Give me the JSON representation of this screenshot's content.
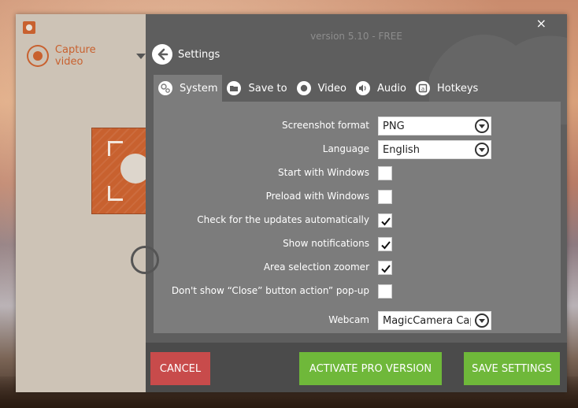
{
  "app": {
    "version": "version 5.10 - FREE",
    "close_symbol": "×"
  },
  "left": {
    "capture_label": "Capture video"
  },
  "header": {
    "back_label": "Settings"
  },
  "tabs": [
    {
      "label": "System",
      "icon": "gears-icon",
      "active": true
    },
    {
      "label": "Save to",
      "icon": "folder-icon",
      "active": false
    },
    {
      "label": "Video",
      "icon": "record-icon",
      "active": false
    },
    {
      "label": "Audio",
      "icon": "speaker-icon",
      "active": false
    },
    {
      "label": "Hotkeys",
      "icon": "keyboard-key-icon",
      "active": false
    }
  ],
  "settings": {
    "screenshot_format": {
      "label": "Screenshot format",
      "value": "PNG"
    },
    "language": {
      "label": "Language",
      "value": "English"
    },
    "start_with_windows": {
      "label": "Start with Windows",
      "checked": false
    },
    "preload_with_windows": {
      "label": "Preload with Windows",
      "checked": false
    },
    "check_updates": {
      "label": "Check for the updates automatically",
      "checked": true
    },
    "show_notifications": {
      "label": "Show notifications",
      "checked": true
    },
    "area_zoomer": {
      "label": "Area selection zoomer",
      "checked": true
    },
    "dont_show_close": {
      "label": "Don't show “Close” button action” pop-up",
      "checked": false
    },
    "webcam": {
      "label": "Webcam",
      "value": "MagicCamera Cap"
    }
  },
  "footer": {
    "cancel_label": "CANCEL",
    "pro_label": "ACTIVATE PRO VERSION",
    "save_label": "SAVE SETTINGS"
  },
  "colors": {
    "accent": "#c8612f",
    "green": "#6fb83a",
    "red": "#c84b4b",
    "panel": "#7c7c7c",
    "dark": "#5e5e5e"
  }
}
